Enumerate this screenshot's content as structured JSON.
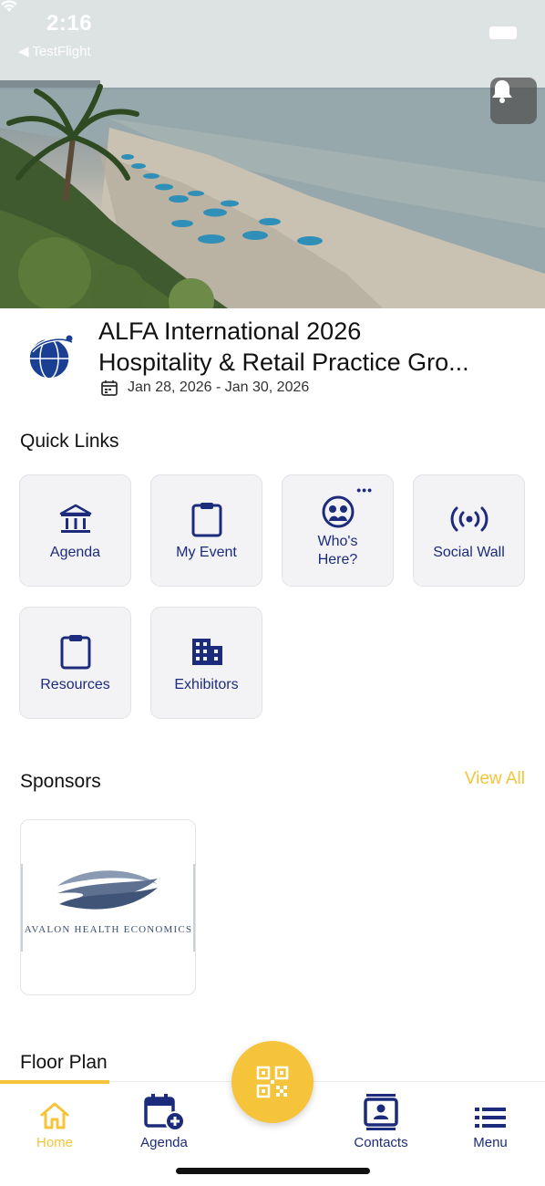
{
  "status_bar": {
    "time": "2:16",
    "back_app": "◀ TestFlight"
  },
  "event": {
    "title_line1": "ALFA International 2026",
    "title_line2": "Hospitality & Retail Practice Gro...",
    "dates": "Jan 28, 2026 - Jan 30, 2026"
  },
  "quick_links": {
    "heading": "Quick Links",
    "items": [
      {
        "label": "Agenda",
        "icon": "bank-icon"
      },
      {
        "label": "My Event",
        "icon": "clipboard-icon"
      },
      {
        "label_line1": "Who's",
        "label_line2": "Here?",
        "icon": "people-icon",
        "more": "•••"
      },
      {
        "label": "Social Wall",
        "icon": "broadcast-icon"
      },
      {
        "label": "Resources",
        "icon": "clipboard-icon"
      },
      {
        "label": "Exhibitors",
        "icon": "building-icon"
      }
    ]
  },
  "sponsors": {
    "heading": "Sponsors",
    "view_all": "View All",
    "items": [
      {
        "name": "Avalon Health Economics"
      }
    ]
  },
  "floor_plan": {
    "heading": "Floor Plan"
  },
  "bottom_nav": {
    "items": [
      {
        "label": "Home",
        "active": true
      },
      {
        "label": "Agenda"
      },
      {
        "label": "Contacts"
      },
      {
        "label": "Menu"
      }
    ]
  },
  "colors": {
    "accent": "#f6c43a",
    "primary": "#1c2b7c",
    "tile_bg": "#f3f3f5"
  }
}
